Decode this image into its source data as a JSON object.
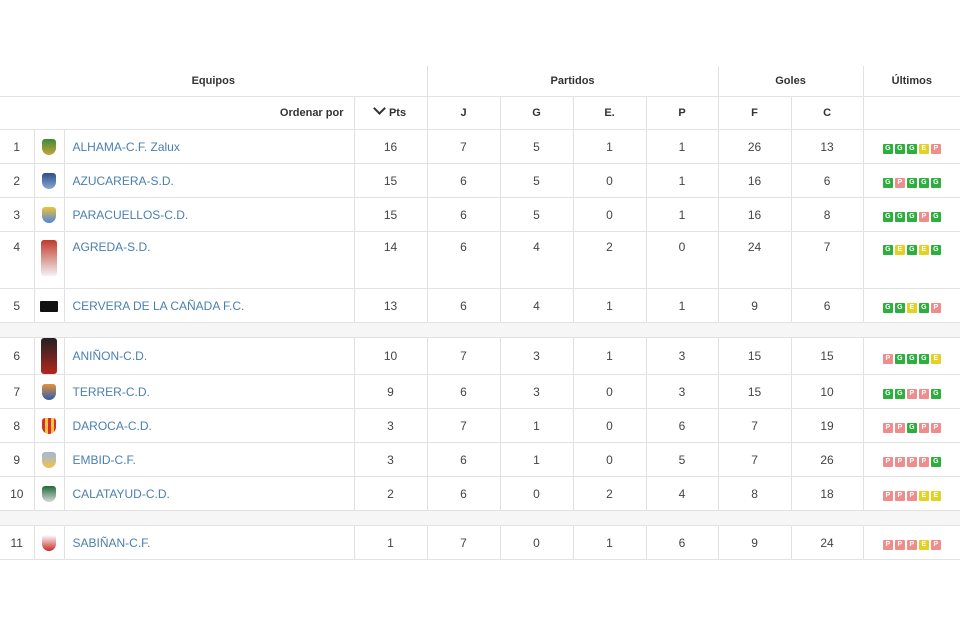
{
  "header": {
    "equipos": "Equipos",
    "partidos": "Partidos",
    "goles": "Goles",
    "ultimos": "Últimos",
    "ordenar_por": "Ordenar por",
    "pts": "Pts",
    "j": "J",
    "g": "G",
    "e": "E.",
    "p": "P",
    "f": "F",
    "c": "C"
  },
  "colors": {
    "win": "#2eae3f",
    "draw": "#e3d224",
    "loss": "#ef8c8c",
    "link": "#4a7fb0"
  },
  "teams": [
    {
      "pos": "1",
      "name": "ALHAMA-C.F. Zalux",
      "pts": "16",
      "j": "7",
      "g": "5",
      "e": "1",
      "p": "1",
      "f": "26",
      "c": "13",
      "form": [
        "G",
        "G",
        "G",
        "E",
        "P"
      ],
      "crest": "crest-icon"
    },
    {
      "pos": "2",
      "name": "AZUCARERA-S.D.",
      "pts": "15",
      "j": "6",
      "g": "5",
      "e": "0",
      "p": "1",
      "f": "16",
      "c": "6",
      "form": [
        "G",
        "P",
        "G",
        "G",
        "G"
      ],
      "crest": "crest-icon"
    },
    {
      "pos": "3",
      "name": "PARACUELLOS-C.D.",
      "pts": "15",
      "j": "6",
      "g": "5",
      "e": "0",
      "p": "1",
      "f": "16",
      "c": "8",
      "form": [
        "G",
        "G",
        "G",
        "P",
        "G"
      ],
      "crest": "crest-icon"
    },
    {
      "pos": "4",
      "name": "AGREDA-S.D.",
      "pts": "14",
      "j": "6",
      "g": "4",
      "e": "2",
      "p": "0",
      "f": "24",
      "c": "7",
      "form": [
        "G",
        "E",
        "G",
        "E",
        "G"
      ],
      "crest": "crest-icon"
    },
    {
      "pos": "5",
      "name": "CERVERA DE LA CAÑADA F.C.",
      "pts": "13",
      "j": "6",
      "g": "4",
      "e": "1",
      "p": "1",
      "f": "9",
      "c": "6",
      "form": [
        "G",
        "G",
        "E",
        "G",
        "P"
      ],
      "crest": "crest-icon"
    },
    {
      "pos": "6",
      "name": "ANIÑON-C.D.",
      "pts": "10",
      "j": "7",
      "g": "3",
      "e": "1",
      "p": "3",
      "f": "15",
      "c": "15",
      "form": [
        "P",
        "G",
        "G",
        "G",
        "E"
      ],
      "crest": "crest-icon"
    },
    {
      "pos": "7",
      "name": "TERRER-C.D.",
      "pts": "9",
      "j": "6",
      "g": "3",
      "e": "0",
      "p": "3",
      "f": "15",
      "c": "10",
      "form": [
        "G",
        "G",
        "P",
        "P",
        "G"
      ],
      "crest": "crest-icon"
    },
    {
      "pos": "8",
      "name": "DAROCA-C.D.",
      "pts": "3",
      "j": "7",
      "g": "1",
      "e": "0",
      "p": "6",
      "f": "7",
      "c": "19",
      "form": [
        "P",
        "P",
        "G",
        "P",
        "P"
      ],
      "crest": "crest-icon"
    },
    {
      "pos": "9",
      "name": "EMBID-C.F.",
      "pts": "3",
      "j": "6",
      "g": "1",
      "e": "0",
      "p": "5",
      "f": "7",
      "c": "26",
      "form": [
        "P",
        "P",
        "P",
        "P",
        "G"
      ],
      "crest": "crest-icon"
    },
    {
      "pos": "10",
      "name": "CALATAYUD-C.D.",
      "pts": "2",
      "j": "6",
      "g": "0",
      "e": "2",
      "p": "4",
      "f": "8",
      "c": "18",
      "form": [
        "P",
        "P",
        "P",
        "E",
        "E"
      ],
      "crest": "crest-icon"
    },
    {
      "pos": "11",
      "name": "SABIÑAN-C.F.",
      "pts": "1",
      "j": "7",
      "g": "0",
      "e": "1",
      "p": "6",
      "f": "9",
      "c": "24",
      "form": [
        "P",
        "P",
        "P",
        "E",
        "P"
      ],
      "crest": "crest-icon"
    }
  ]
}
